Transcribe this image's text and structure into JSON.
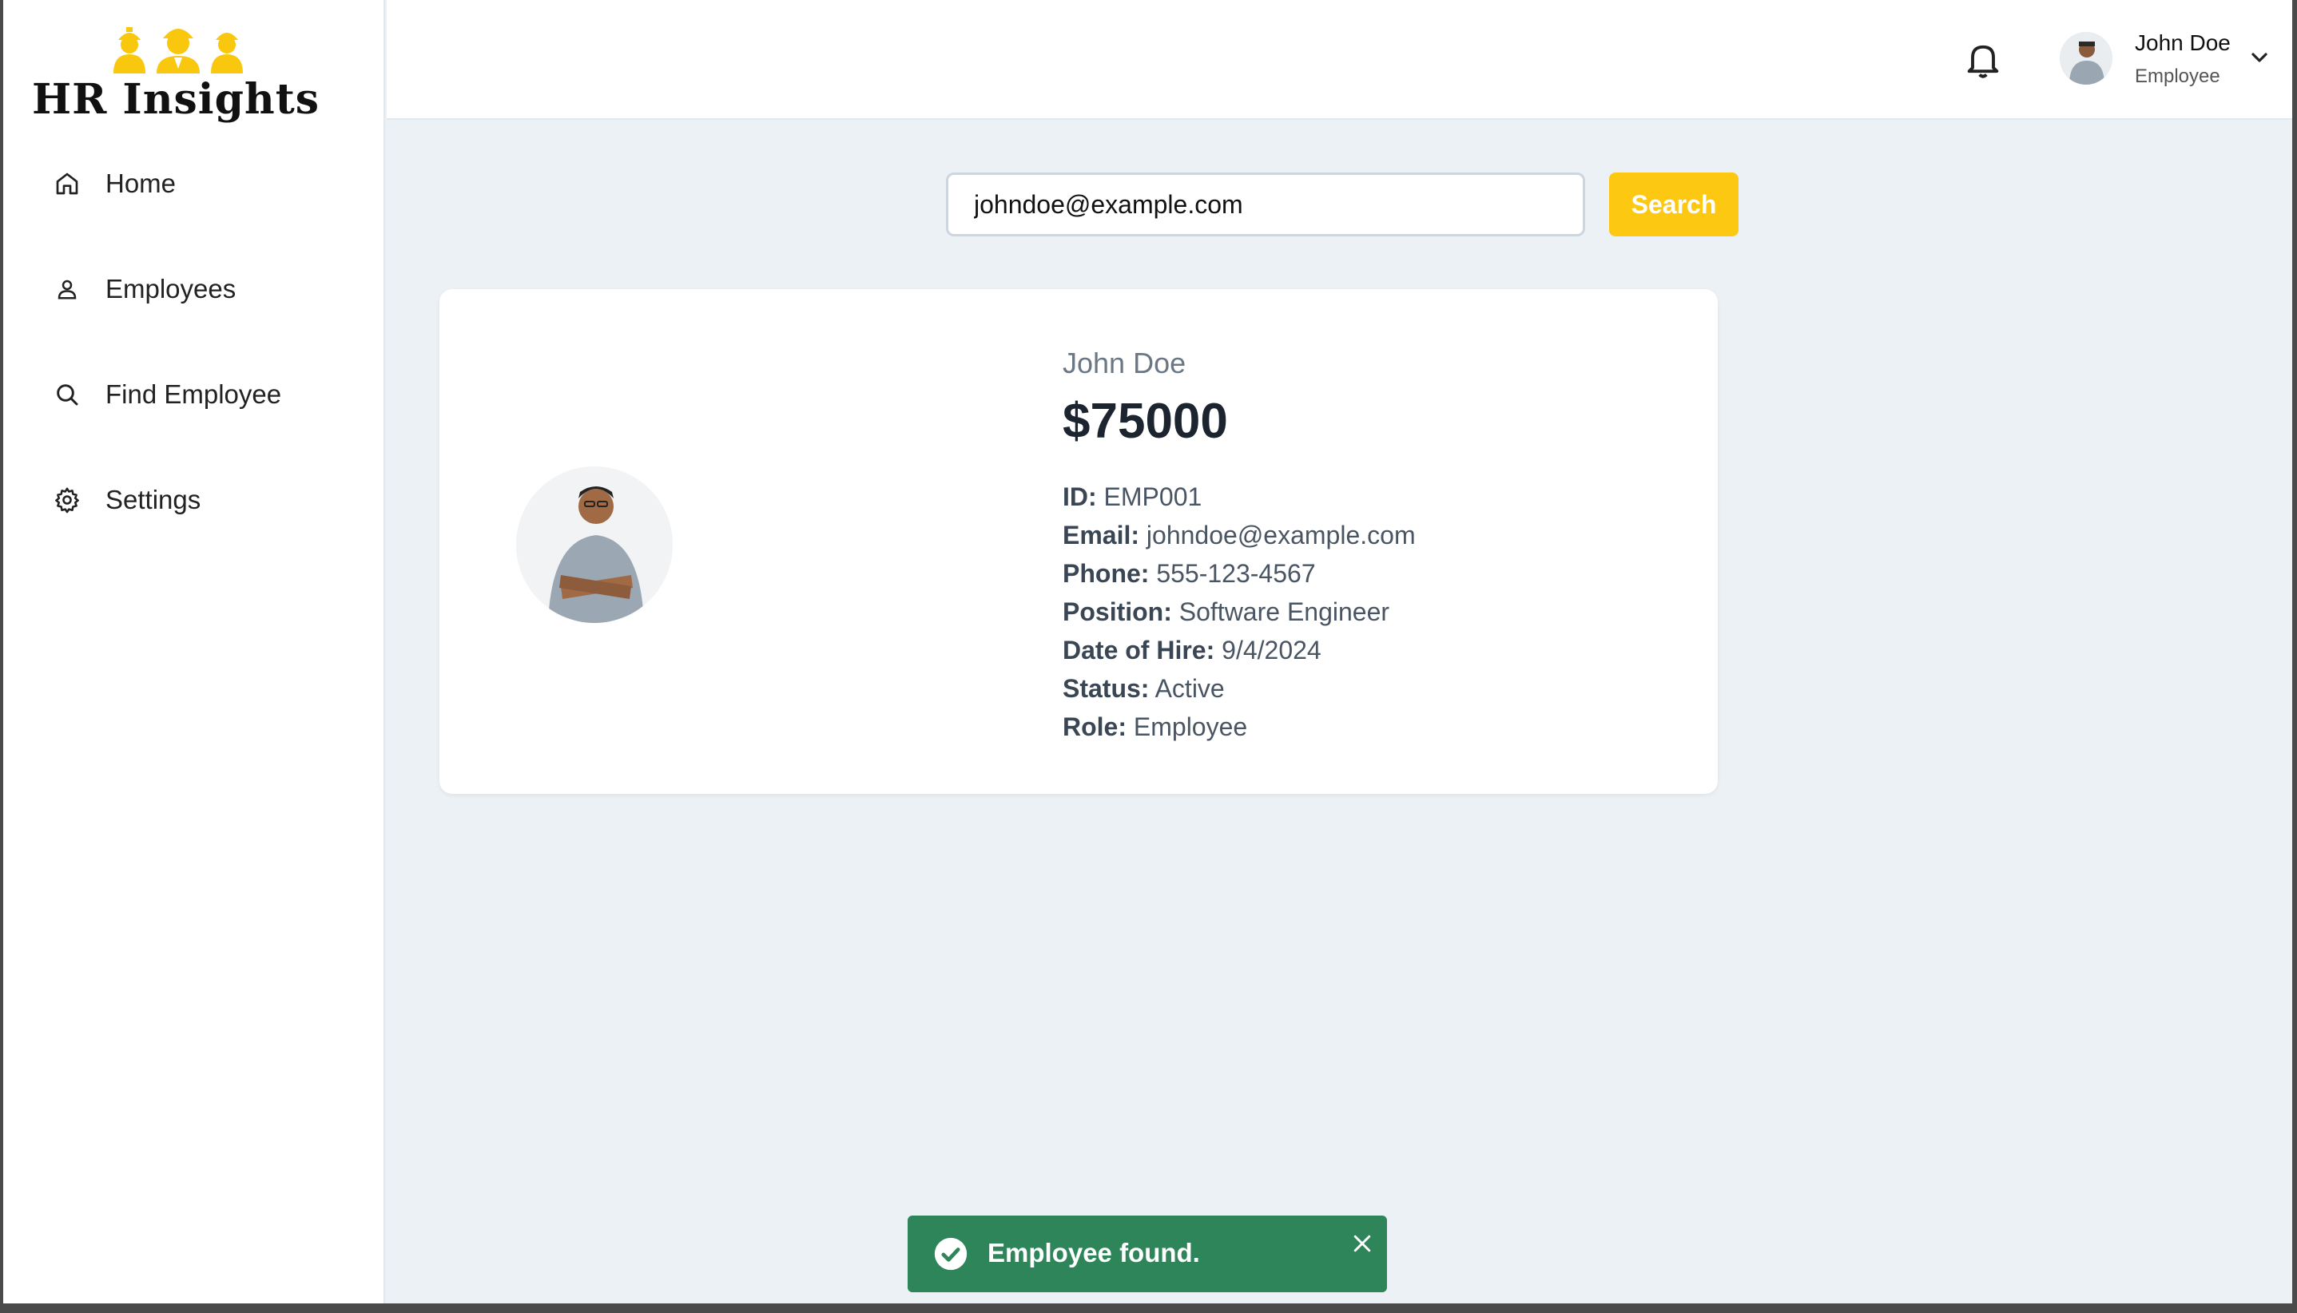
{
  "app": {
    "title": "HR Insights"
  },
  "sidebar": {
    "items": [
      {
        "label": "Home",
        "icon": "home-icon"
      },
      {
        "label": "Employees",
        "icon": "user-icon"
      },
      {
        "label": "Find Employee",
        "icon": "search-icon"
      },
      {
        "label": "Settings",
        "icon": "gear-icon"
      }
    ]
  },
  "header": {
    "user_name": "John Doe",
    "user_role": "Employee"
  },
  "search": {
    "value": "johndoe@example.com",
    "button_label": "Search"
  },
  "employee": {
    "name": "John Doe",
    "salary": "$75000",
    "fields": [
      {
        "label": "ID:",
        "value": "EMP001"
      },
      {
        "label": "Email:",
        "value": "johndoe@example.com"
      },
      {
        "label": "Phone:",
        "value": "555-123-4567"
      },
      {
        "label": "Position:",
        "value": "Software Engineer"
      },
      {
        "label": "Date of Hire:",
        "value": "9/4/2024"
      },
      {
        "label": "Status:",
        "value": "Active"
      },
      {
        "label": "Role:",
        "value": "Employee"
      }
    ]
  },
  "toast": {
    "message": "Employee found."
  },
  "colors": {
    "accent": "#fcc811",
    "toast": "#2f855a",
    "background": "#ecf1f5"
  }
}
